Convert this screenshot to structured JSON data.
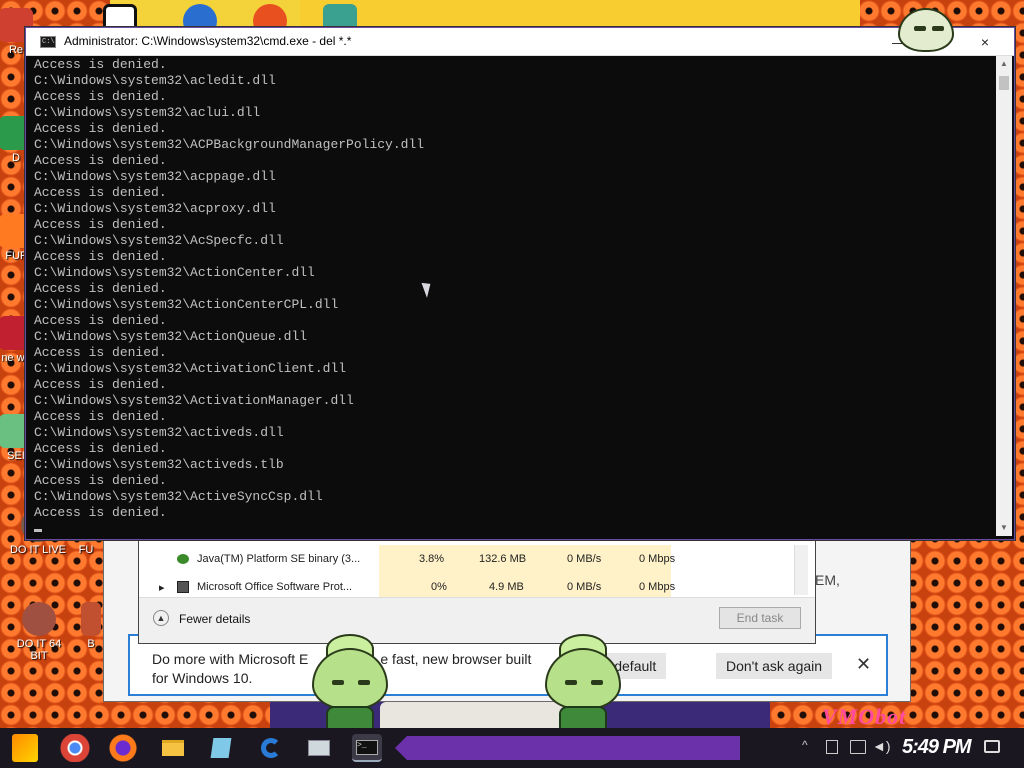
{
  "desktop": {
    "icons": [
      {
        "label": "Re",
        "color": "#d04030"
      },
      {
        "label": "D",
        "color": "#2b9a4a"
      },
      {
        "label": "FUF",
        "color": "#ff7a20"
      },
      {
        "label": "ne wh",
        "color": "#c02030"
      },
      {
        "label": "SEI",
        "color": "#6ac080"
      },
      {
        "label": "DO IT LIVE",
        "color": "#7a5a4a"
      },
      {
        "label": "FU",
        "color": "#d08040"
      },
      {
        "label": "DO IT 64 BIT",
        "color": "#a05040"
      },
      {
        "label": "B",
        "color": "#c05030"
      }
    ],
    "watermark": "VMObot",
    "colors": {
      "wallpaper": "#c8420f",
      "taskbar": "#1a1720",
      "accent": "#7a36c4"
    }
  },
  "cmd": {
    "title": "Administrator: C:\\Windows\\system32\\cmd.exe - del  *.*",
    "minimize_glyph": "—",
    "close_glyph": "×",
    "lines": [
      "Access is denied.",
      "C:\\Windows\\system32\\acledit.dll",
      "Access is denied.",
      "C:\\Windows\\system32\\aclui.dll",
      "Access is denied.",
      "C:\\Windows\\system32\\ACPBackgroundManagerPolicy.dll",
      "Access is denied.",
      "C:\\Windows\\system32\\acppage.dll",
      "Access is denied.",
      "C:\\Windows\\system32\\acproxy.dll",
      "Access is denied.",
      "C:\\Windows\\system32\\AcSpecfc.dll",
      "Access is denied.",
      "C:\\Windows\\system32\\ActionCenter.dll",
      "Access is denied.",
      "C:\\Windows\\system32\\ActionCenterCPL.dll",
      "Access is denied.",
      "C:\\Windows\\system32\\ActionQueue.dll",
      "Access is denied.",
      "C:\\Windows\\system32\\ActivationClient.dll",
      "Access is denied.",
      "C:\\Windows\\system32\\ActivationManager.dll",
      "Access is denied.",
      "C:\\Windows\\system32\\activeds.dll",
      "Access is denied.",
      "C:\\Windows\\system32\\activeds.tlb",
      "Access is denied.",
      "C:\\Windows\\system32\\ActiveSyncCsp.dll",
      "Access is denied."
    ]
  },
  "task_manager": {
    "rows": [
      {
        "name": "Java(TM) Platform SE binary (3...",
        "cpu": "3.8%",
        "memory": "132.6 MB",
        "disk": "0 MB/s",
        "network": "0 Mbps"
      },
      {
        "name": "Microsoft Office Software Prot...",
        "cpu": "0%",
        "memory": "4.9 MB",
        "disk": "0 MB/s",
        "network": "0 Mbps"
      }
    ],
    "fewer_details": "Fewer details",
    "end_task": "End task"
  },
  "edge_bar": {
    "message_line1": "Do more with Microsoft E",
    "message_line1_tail": "e fast, new browser built",
    "message_line2": "for Windows 10.",
    "make_default": "e my default",
    "dont_ask": "Don't ask again",
    "close_glyph": "✕",
    "right_clip": "EM,"
  },
  "taskbar": {
    "time": "5:49 PM",
    "items": [
      "start",
      "chrome",
      "firefox",
      "file-explorer",
      "notepad",
      "edge",
      "task-manager",
      "cmd"
    ]
  }
}
